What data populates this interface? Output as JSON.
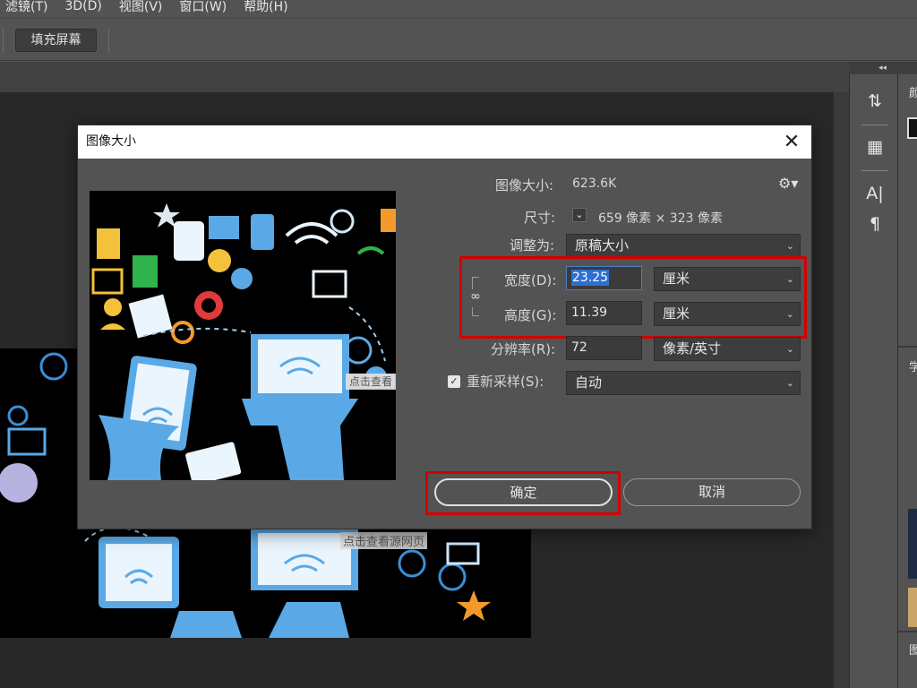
{
  "menu": [
    "滤镜(T)",
    "3D(D)",
    "视图(V)",
    "窗口(W)",
    "帮助(H)"
  ],
  "options_bar": {
    "fill_screen": "填充屏幕"
  },
  "right_panel": {
    "collapse": "◂◂",
    "panel1_char": "颜",
    "panel2_char": "学",
    "panel3_char": "图"
  },
  "dialog": {
    "title": "图像大小",
    "image_size_label": "图像大小:",
    "image_size_value": "623.6K",
    "dimensions_label": "尺寸:",
    "dimensions_value": "659 像素  ×  323 像素",
    "fit_label": "调整为:",
    "fit_value": "原稿大小",
    "width_label": "宽度(D):",
    "width_value": "23.25",
    "width_unit": "厘米",
    "height_label": "高度(G):",
    "height_value": "11.39",
    "height_unit": "厘米",
    "resolution_label": "分辨率(R):",
    "resolution_value": "72",
    "resolution_unit": "像素/英寸",
    "resample_label": "重新采样(S):",
    "resample_value": "自动",
    "ok": "确定",
    "cancel": "取消",
    "resample_checked": true
  },
  "watermark": "点击查看源网页",
  "watermark_short": "点击查看"
}
